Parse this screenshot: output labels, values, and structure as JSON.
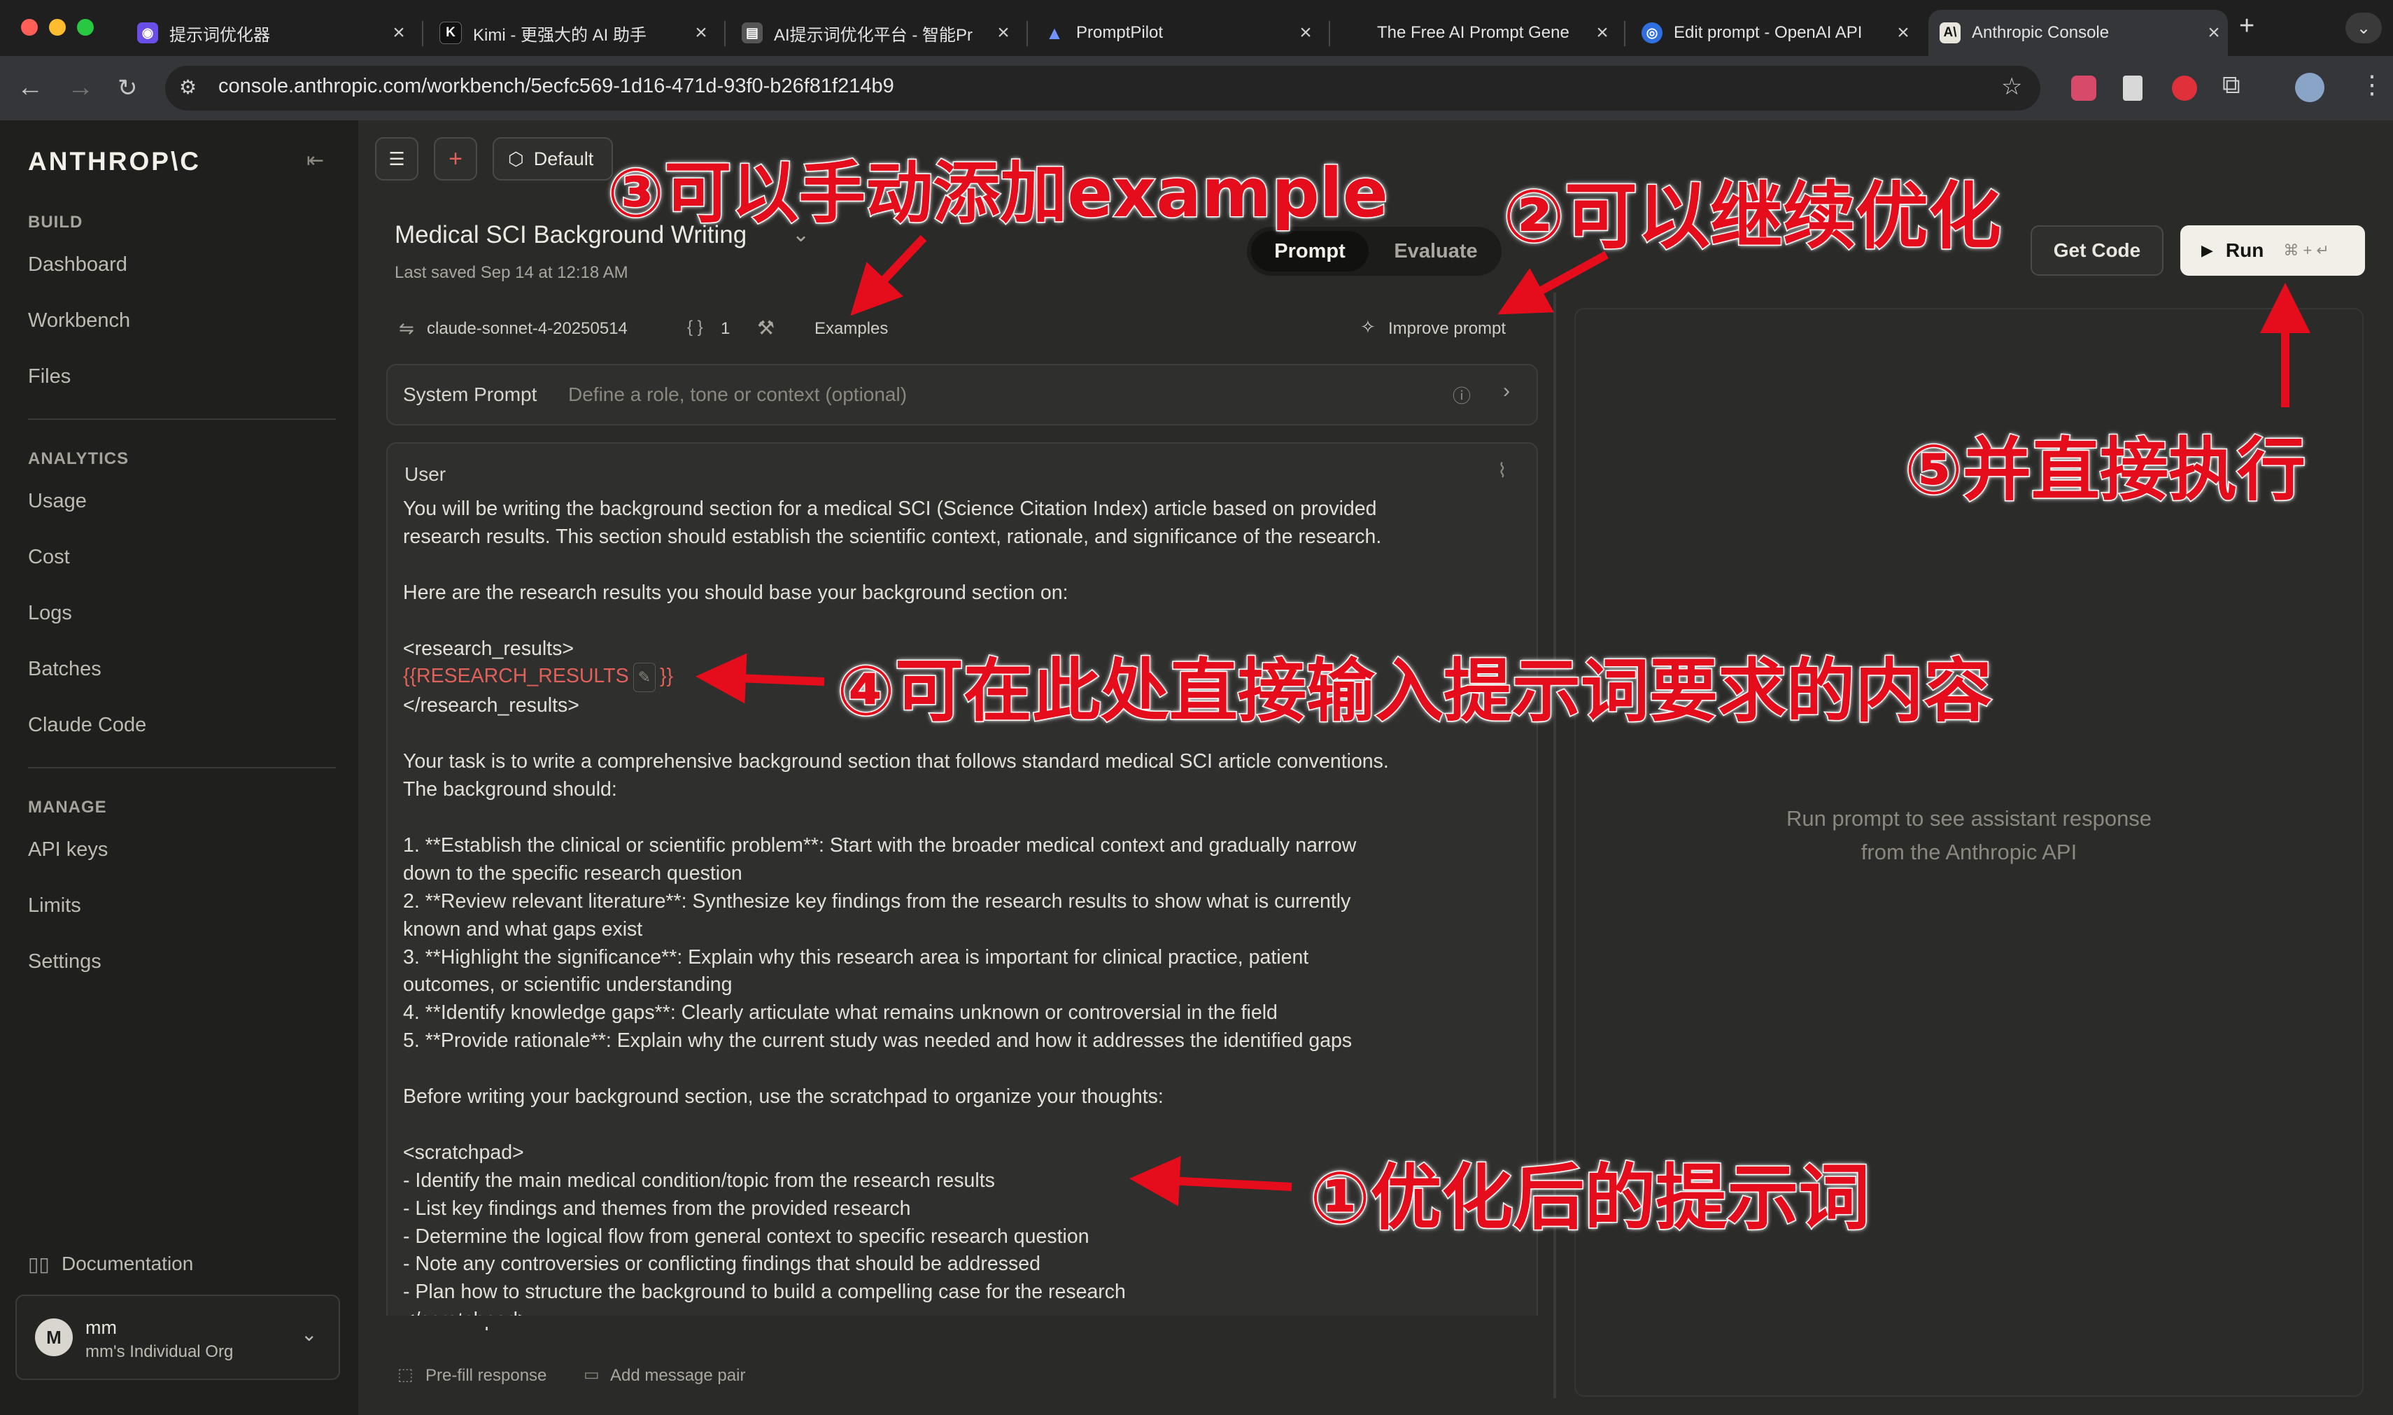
{
  "browser": {
    "tabs": [
      {
        "title": "提示词优化器",
        "icon": "shield-icon",
        "color": "#6a4ee8"
      },
      {
        "title": "Kimi - 更强大的 AI 助手",
        "icon": "kimi-logo-icon",
        "color": "#111111"
      },
      {
        "title": "AI提示词优化平台 - 智能Pr",
        "icon": "document-icon",
        "color": "#555555"
      },
      {
        "title": "PromptPilot",
        "icon": "pilot-logo-icon",
        "color": "#3b6ee8"
      },
      {
        "title": "The Free AI Prompt Gene",
        "icon": "",
        "color": ""
      },
      {
        "title": "Edit prompt - OpenAI API",
        "icon": "globe-icon",
        "color": "#2f6fe0"
      },
      {
        "title": "Anthropic Console",
        "icon": "anthropic-logo-icon",
        "color": "#e8e6dc"
      }
    ],
    "url": "console.anthropic.com/workbench/5ecfc569-1d16-471d-93f0-b26f81f214b9"
  },
  "sidebar": {
    "brand": "ANTHROP\\C",
    "sections": [
      {
        "title": "BUILD",
        "items": [
          "Dashboard",
          "Workbench",
          "Files"
        ]
      },
      {
        "title": "ANALYTICS",
        "items": [
          "Usage",
          "Cost",
          "Logs",
          "Batches",
          "Claude Code"
        ]
      },
      {
        "title": "MANAGE",
        "items": [
          "API keys",
          "Limits",
          "Settings"
        ]
      }
    ],
    "documentation": "Documentation",
    "user": {
      "initial": "M",
      "name": "mm",
      "org": "mm's Individual Org"
    }
  },
  "workbench": {
    "default_label": "Default",
    "title": "Medical SCI Background Writing",
    "last_saved": "Last saved Sep 14 at 12:18 AM",
    "model": "claude-sonnet-4-20250514",
    "variables_count": "1",
    "examples_label": "Examples",
    "improve_label": "Improve prompt",
    "tab_prompt": "Prompt",
    "tab_evaluate": "Evaluate",
    "get_code": "Get Code",
    "run": "Run",
    "run_shortcut": "⌘ + ↵",
    "system_label": "System Prompt",
    "system_placeholder": "Define a role, tone or context (optional)",
    "user_label": "User",
    "prompt_before": "You will be writing the background section for a medical SCI (Science Citation Index) article based on provided\nresearch results. This section should establish the scientific context, rationale, and significance of the research.\n\nHere are the research results you should base your background section on:\n\n<research_results>",
    "variable": "{{RESEARCH_RESULTS",
    "variable_close": "}}",
    "prompt_after": "</research_results>\n\nYour task is to write a comprehensive background section that follows standard medical SCI article conventions.\nThe background should:\n\n1. **Establish the clinical or scientific problem**: Start with the broader medical context and gradually narrow\ndown to the specific research question\n2. **Review relevant literature**: Synthesize key findings from the research results to show what is currently\nknown and what gaps exist\n3. **Highlight the significance**: Explain why this research area is important for clinical practice, patient\noutcomes, or scientific understanding\n4. **Identify knowledge gaps**: Clearly articulate what remains unknown or controversial in the field\n5. **Provide rationale**: Explain why the current study was needed and how it addresses the identified gaps\n\nBefore writing your background section, use the scratchpad to organize your thoughts:\n\n<scratchpad>\n- Identify the main medical condition/topic from the research results\n- List key findings and themes from the provided research\n- Determine the logical flow from general context to specific research question\n- Note any controversies or conflicting findings that should be addressed\n- Plan how to structure the background to build a compelling case for the research\n</scratchpad>",
    "prefill": "Pre-fill response",
    "add_pair": "Add message pair",
    "response_placeholder": "Run prompt to see assistant response\nfrom the Anthropic API"
  },
  "annotations": {
    "a1": "①优化后的提示词",
    "a2": "②可以继续优化",
    "a3": "③可以手动添加example",
    "a4": "④可在此处直接输入提示词要求的内容",
    "a5": "⑤并直接执行"
  },
  "colors": {
    "accent_red": "#e50d1c",
    "variable": "#e0605a",
    "sidebar_bg": "#1f1f1e",
    "main_bg": "#2a2a29"
  }
}
